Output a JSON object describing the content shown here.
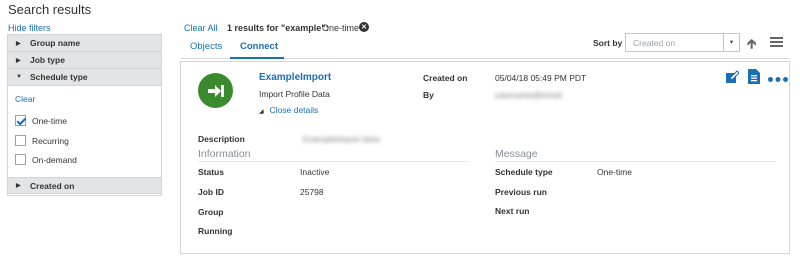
{
  "page": {
    "title": "Search results",
    "hide_filters": "Hide filters"
  },
  "filters": {
    "group_name": "Group name",
    "job_type": "Job type",
    "schedule_type": "Schedule type",
    "clear": "Clear",
    "options": [
      {
        "label": "One-time",
        "checked": true
      },
      {
        "label": "Recurring",
        "checked": false
      },
      {
        "label": "On-demand",
        "checked": false
      }
    ],
    "created_on": "Created on"
  },
  "results_bar": {
    "clear_all": "Clear All",
    "count": "1 results for \"example\":",
    "filter": "One-time"
  },
  "tabs": {
    "objects": "Objects",
    "connect": "Connect"
  },
  "sort": {
    "label": "Sort by",
    "placeholder": "Created on"
  },
  "job": {
    "name": "ExampleImport",
    "subtitle": "Import Profile Data",
    "close_details": "Close details",
    "created_on_label": "Created on",
    "created_on_value": "05/04/18 05:49 PM PDT",
    "by_label": "By",
    "by_value": "username@email",
    "description_label": "Description",
    "description_value": "ExampleImport desc",
    "information_title": "Information",
    "message_title": "Message",
    "status_label": "Status",
    "status_value": "Inactive",
    "job_id_label": "Job ID",
    "job_id_value": "25798",
    "group_label": "Group",
    "running_label": "Running",
    "schedule_type_label": "Schedule type",
    "schedule_type_value": "One-time",
    "previous_run_label": "Previous run",
    "next_run_label": "Next run"
  },
  "colors": {
    "accent": "#1a6fb5",
    "job_icon": "#3a8a2e",
    "facet_header": "#e2e4e8"
  }
}
